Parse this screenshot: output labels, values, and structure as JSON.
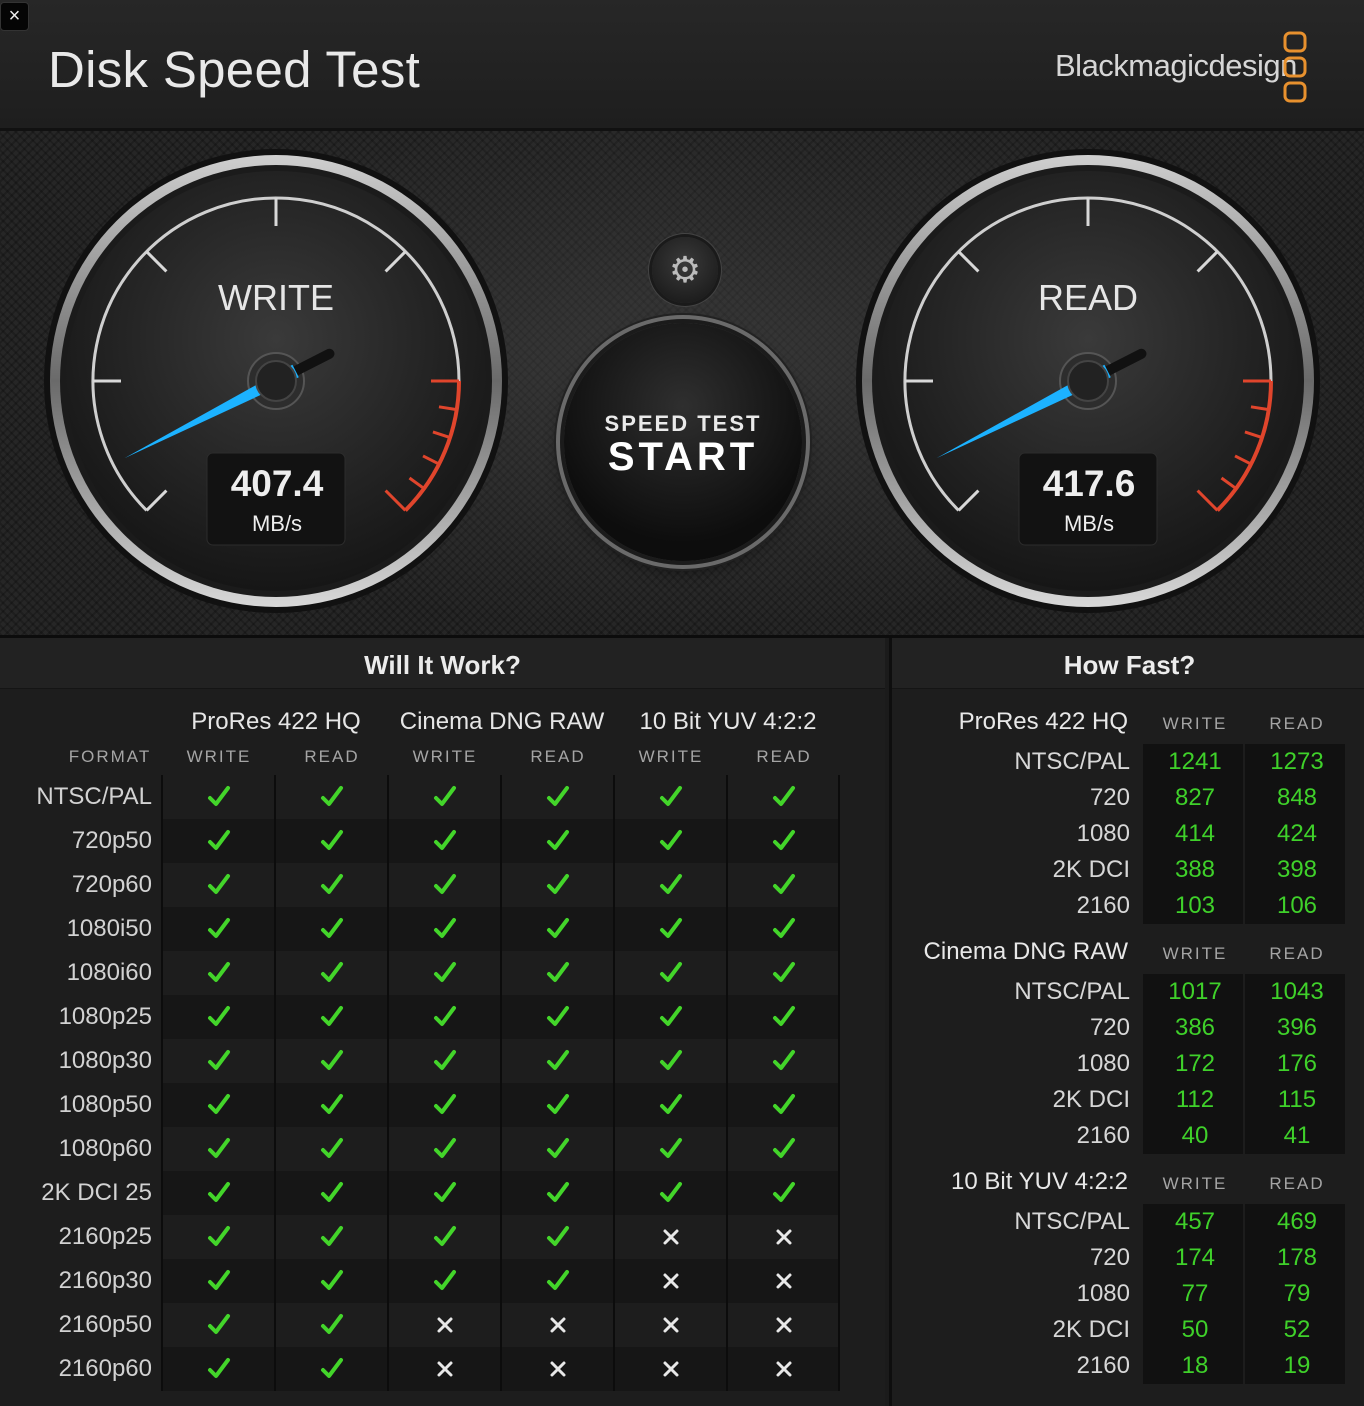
{
  "window": {
    "title": "Disk Speed Test",
    "brand": "Blackmagicdesign",
    "close_glyph": "×",
    "icons": [
      "close-icon",
      "blackmagic-logo-icon",
      "gear-icon",
      "check-icon",
      "cross-icon"
    ]
  },
  "colors": {
    "needle": "#1cb2ff",
    "redzone": "#e0452c",
    "ok": "#43d52a",
    "value_green": "#3fd12a",
    "logo_orange": "#e8912e"
  },
  "gauges": {
    "write": {
      "label": "WRITE",
      "value": "407.4",
      "unit": "MB/s"
    },
    "read": {
      "label": "READ",
      "value": "417.6",
      "unit": "MB/s"
    }
  },
  "start_button": {
    "sub": "SPEED TEST",
    "main": "START"
  },
  "will_it_work": {
    "title": "Will It Work?",
    "format_header": "FORMAT",
    "codecs": [
      "ProRes 422 HQ",
      "Cinema DNG RAW",
      "10 Bit YUV 4:2:2"
    ],
    "col_write": "WRITE",
    "col_read": "READ",
    "rows": [
      {
        "label": "NTSC/PAL",
        "ok": [
          1,
          1,
          1,
          1,
          1,
          1
        ]
      },
      {
        "label": "720p50",
        "ok": [
          1,
          1,
          1,
          1,
          1,
          1
        ]
      },
      {
        "label": "720p60",
        "ok": [
          1,
          1,
          1,
          1,
          1,
          1
        ]
      },
      {
        "label": "1080i50",
        "ok": [
          1,
          1,
          1,
          1,
          1,
          1
        ]
      },
      {
        "label": "1080i60",
        "ok": [
          1,
          1,
          1,
          1,
          1,
          1
        ]
      },
      {
        "label": "1080p25",
        "ok": [
          1,
          1,
          1,
          1,
          1,
          1
        ]
      },
      {
        "label": "1080p30",
        "ok": [
          1,
          1,
          1,
          1,
          1,
          1
        ]
      },
      {
        "label": "1080p50",
        "ok": [
          1,
          1,
          1,
          1,
          1,
          1
        ]
      },
      {
        "label": "1080p60",
        "ok": [
          1,
          1,
          1,
          1,
          1,
          1
        ]
      },
      {
        "label": "2K DCI 25",
        "ok": [
          1,
          1,
          1,
          1,
          1,
          1
        ]
      },
      {
        "label": "2160p25",
        "ok": [
          1,
          1,
          1,
          1,
          0,
          0
        ]
      },
      {
        "label": "2160p30",
        "ok": [
          1,
          1,
          1,
          1,
          0,
          0
        ]
      },
      {
        "label": "2160p50",
        "ok": [
          1,
          1,
          0,
          0,
          0,
          0
        ]
      },
      {
        "label": "2160p60",
        "ok": [
          1,
          1,
          0,
          0,
          0,
          0
        ]
      }
    ]
  },
  "how_fast": {
    "title": "How Fast?",
    "col_write": "WRITE",
    "col_read": "READ",
    "groups": [
      {
        "name": "ProRes 422 HQ",
        "rows": [
          {
            "label": "NTSC/PAL",
            "write": "1241",
            "read": "1273"
          },
          {
            "label": "720",
            "write": "827",
            "read": "848"
          },
          {
            "label": "1080",
            "write": "414",
            "read": "424"
          },
          {
            "label": "2K DCI",
            "write": "388",
            "read": "398"
          },
          {
            "label": "2160",
            "write": "103",
            "read": "106"
          }
        ]
      },
      {
        "name": "Cinema DNG RAW",
        "rows": [
          {
            "label": "NTSC/PAL",
            "write": "1017",
            "read": "1043"
          },
          {
            "label": "720",
            "write": "386",
            "read": "396"
          },
          {
            "label": "1080",
            "write": "172",
            "read": "176"
          },
          {
            "label": "2K DCI",
            "write": "112",
            "read": "115"
          },
          {
            "label": "2160",
            "write": "40",
            "read": "41"
          }
        ]
      },
      {
        "name": "10 Bit YUV 4:2:2",
        "rows": [
          {
            "label": "NTSC/PAL",
            "write": "457",
            "read": "469"
          },
          {
            "label": "720",
            "write": "174",
            "read": "178"
          },
          {
            "label": "1080",
            "write": "77",
            "read": "79"
          },
          {
            "label": "2K DCI",
            "write": "50",
            "read": "52"
          },
          {
            "label": "2160",
            "write": "18",
            "read": "19"
          }
        ]
      }
    ]
  }
}
